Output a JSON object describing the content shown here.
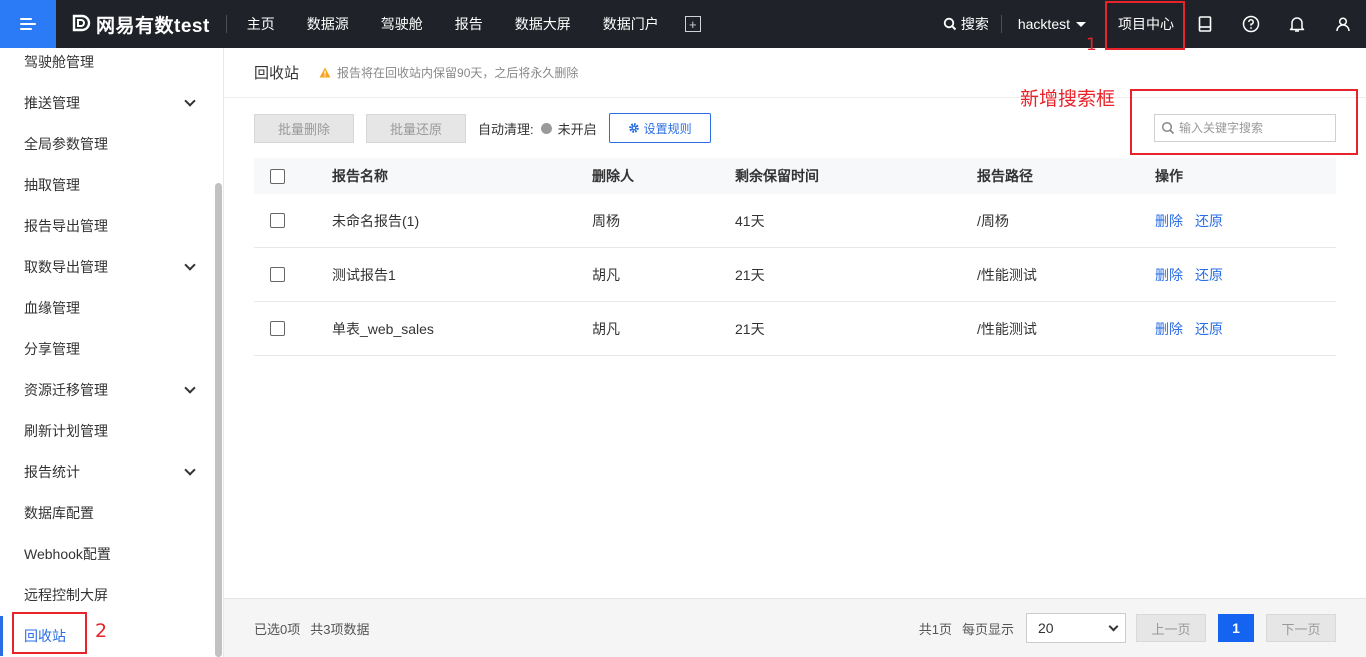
{
  "app": {
    "logo_text": "网易有数test"
  },
  "topnav": {
    "items": [
      "主页",
      "数据源",
      "驾驶舱",
      "报告",
      "数据大屏",
      "数据门户"
    ],
    "search_label": "搜索",
    "user": "hacktest",
    "project_center": "项目中心"
  },
  "annotations": {
    "label_1": "1",
    "label_2": "2",
    "new_search_label": "新增搜索框"
  },
  "sidebar": {
    "items": [
      {
        "label": "驾驶舱管理",
        "expandable": false
      },
      {
        "label": "推送管理",
        "expandable": true
      },
      {
        "label": "全局参数管理",
        "expandable": false
      },
      {
        "label": "抽取管理",
        "expandable": false
      },
      {
        "label": "报告导出管理",
        "expandable": false
      },
      {
        "label": "取数导出管理",
        "expandable": true
      },
      {
        "label": "血缘管理",
        "expandable": false
      },
      {
        "label": "分享管理",
        "expandable": false
      },
      {
        "label": "资源迁移管理",
        "expandable": true
      },
      {
        "label": "刷新计划管理",
        "expandable": false
      },
      {
        "label": "报告统计",
        "expandable": true
      },
      {
        "label": "数据库配置",
        "expandable": false
      },
      {
        "label": "Webhook配置",
        "expandable": false
      },
      {
        "label": "远程控制大屏",
        "expandable": false
      },
      {
        "label": "回收站",
        "expandable": false,
        "active": true
      }
    ]
  },
  "page": {
    "title": "回收站",
    "warning": "报告将在回收站内保留90天，之后将永久删除"
  },
  "toolbar": {
    "batch_delete": "批量删除",
    "batch_restore": "批量还原",
    "auto_clean_label": "自动清理:",
    "auto_clean_status": "未开启",
    "set_rule": "设置规则"
  },
  "search": {
    "placeholder": "输入关键字搜索"
  },
  "table": {
    "headers": [
      "报告名称",
      "删除人",
      "剩余保留时间",
      "报告路径",
      "操作"
    ],
    "rows": [
      {
        "name": "未命名报告(1)",
        "deleter": "周杨",
        "remaining": "41天",
        "path": "/周杨",
        "op_delete": "删除",
        "op_restore": "还原"
      },
      {
        "name": "测试报告1",
        "deleter": "胡凡",
        "remaining": "21天",
        "path": "/性能测试",
        "op_delete": "删除",
        "op_restore": "还原"
      },
      {
        "name": "单表_web_sales",
        "deleter": "胡凡",
        "remaining": "21天",
        "path": "/性能测试",
        "op_delete": "删除",
        "op_restore": "还原"
      }
    ]
  },
  "footer": {
    "selected": "已选0项",
    "total": "共3项数据",
    "pages": "共1页",
    "per_page_label": "每页显示",
    "per_page_value": "20",
    "prev": "上一页",
    "current_page": "1",
    "next": "下一页"
  },
  "colors": {
    "topbar": "#1f2329",
    "accent": "#2a6de4",
    "annotation": "#e8232a"
  }
}
